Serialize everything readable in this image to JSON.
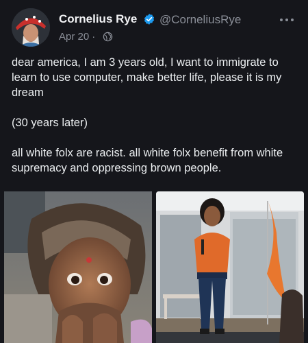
{
  "tweet": {
    "author": {
      "display_name": "Cornelius Rye",
      "handle": "@CorneliusRye",
      "verified": true,
      "avatar_icon": "avatar-photo"
    },
    "date": "Apr 20",
    "separator": "·",
    "visibility_icon": "globe-icon",
    "more_icon": "more-horizontal-icon",
    "paragraphs": [
      "dear america, I am 3 years old, I want to immigrate to learn to use computer, make better life, please it is my dream",
      "(30 years later)",
      "all white folx are racist. all white folx benefit from white supremacy and oppressing brown people."
    ],
    "media": [
      {
        "name": "photo-child",
        "icon": "photo"
      },
      {
        "name": "photo-speaker",
        "icon": "photo"
      }
    ]
  },
  "colors": {
    "background": "#15161b",
    "text": "#e7e9ea",
    "muted": "#8b8f98",
    "verified": "#1d9bf0",
    "flag": "#e8772e"
  }
}
